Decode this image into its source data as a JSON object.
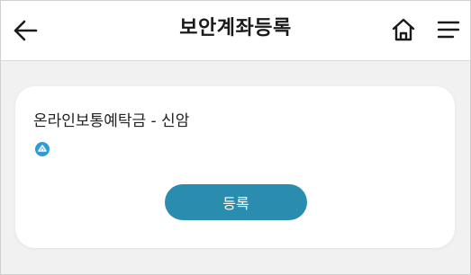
{
  "header": {
    "title": "보안계좌등록",
    "back_icon": "arrow-left-icon",
    "home_icon": "home-icon",
    "menu_icon": "hamburger-menu-icon"
  },
  "account_card": {
    "name": "온라인보통예탁금 - 신암",
    "bank_icon": "bank-logo-icon",
    "register_label": "등록"
  },
  "colors": {
    "accent": "#2a8cae",
    "bank_logo": "#2e9ad8",
    "background": "#f1f1f1",
    "card": "#ffffff"
  }
}
